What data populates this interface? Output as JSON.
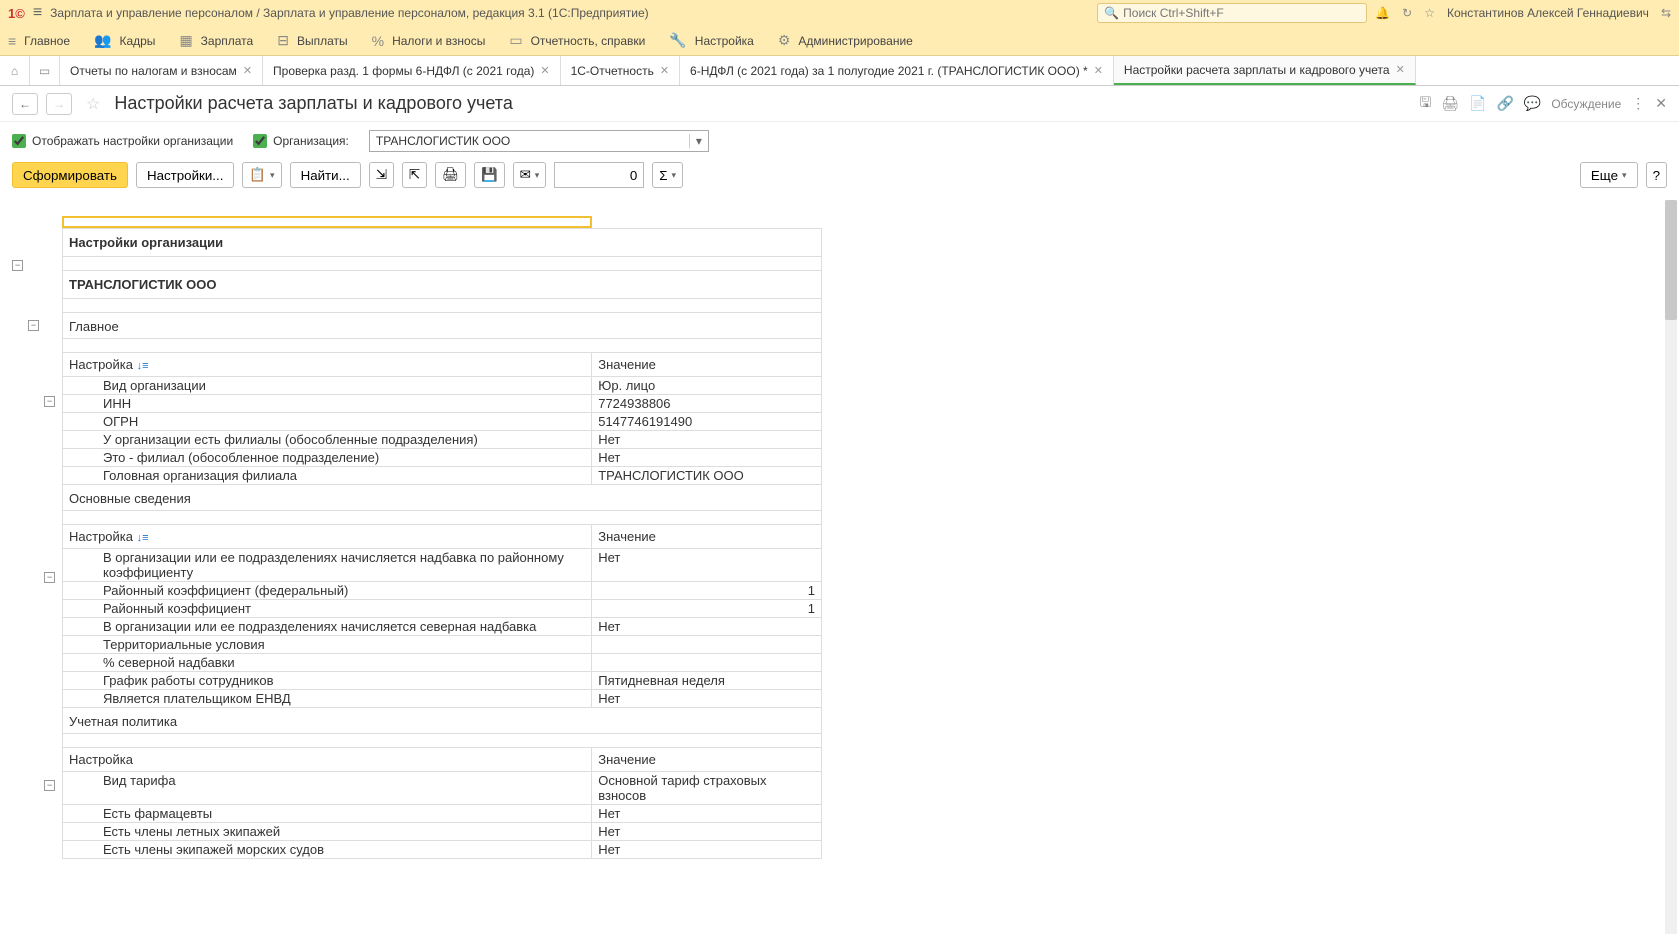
{
  "titlebar": {
    "app_title": "Зарплата и управление персоналом / Зарплата и управление персоналом, редакция 3.1  (1С:Предприятие)",
    "search_placeholder": "Поиск Ctrl+Shift+F",
    "user": "Константинов Алексей Геннадиевич"
  },
  "mainmenu": [
    {
      "icon": "≡",
      "label": "Главное"
    },
    {
      "icon": "👥",
      "label": "Кадры"
    },
    {
      "icon": "▦",
      "label": "Зарплата"
    },
    {
      "icon": "⊟",
      "label": "Выплаты"
    },
    {
      "icon": "%",
      "label": "Налоги и взносы"
    },
    {
      "icon": "▭",
      "label": "Отчетность, справки"
    },
    {
      "icon": "🔧",
      "label": "Настройка"
    },
    {
      "icon": "⚙",
      "label": "Администрирование"
    }
  ],
  "tabs": [
    {
      "label": "Отчеты по налогам и взносам",
      "close": true
    },
    {
      "label": "Проверка разд. 1 формы 6-НДФЛ (с 2021 года)",
      "close": true
    },
    {
      "label": "1С-Отчетность",
      "close": true
    },
    {
      "label": "6-НДФЛ (с 2021 года) за 1 полугодие 2021 г. (ТРАНСЛОГИСТИК ООО) *",
      "close": true
    },
    {
      "label": "Настройки расчета зарплаты и кадрового учета",
      "close": true,
      "active": true
    }
  ],
  "page": {
    "title": "Настройки расчета зарплаты и кадрового учета",
    "discuss": "Обсуждение"
  },
  "filters": {
    "show_org_settings": "Отображать настройки организации",
    "org_label": "Организация:",
    "org_value": "ТРАНСЛОГИСТИК ООО"
  },
  "toolbar": {
    "form": "Сформировать",
    "settings": "Настройки...",
    "find": "Найти...",
    "num_value": "0",
    "more": "Еще",
    "help": "?"
  },
  "report": {
    "h1": "Настройки организации",
    "org_name": "ТРАНСЛОГИСТИК ООО",
    "sections": [
      {
        "title": "Главное",
        "col1": "Настройка",
        "col2": "Значение",
        "sort": true,
        "rows": [
          {
            "k": "Вид организации",
            "v": "Юр. лицо"
          },
          {
            "k": "ИНН",
            "v": "7724938806"
          },
          {
            "k": "ОГРН",
            "v": "5147746191490"
          },
          {
            "k": "У организации есть филиалы (обособленные подразделения)",
            "v": "Нет"
          },
          {
            "k": "Это - филиал (обособленное подразделение)",
            "v": "Нет"
          },
          {
            "k": "Головная организация филиала",
            "v": "ТРАНСЛОГИСТИК ООО"
          }
        ]
      },
      {
        "title": "Основные сведения",
        "col1": "Настройка",
        "col2": "Значение",
        "sort": true,
        "rows": [
          {
            "k": "В организации или ее подразделениях начисляется надбавка по районному коэффициенту",
            "v": "Нет"
          },
          {
            "k": "Районный коэффициент (федеральный)",
            "v": "1",
            "r": true
          },
          {
            "k": "Районный коэффициент",
            "v": "1",
            "r": true
          },
          {
            "k": "В организации или ее подразделениях начисляется северная надбавка",
            "v": "Нет"
          },
          {
            "k": "Территориальные условия",
            "v": ""
          },
          {
            "k": "% северной надбавки",
            "v": ""
          },
          {
            "k": "График работы сотрудников",
            "v": "Пятидневная неделя"
          },
          {
            "k": "Является плательщиком ЕНВД",
            "v": "Нет"
          }
        ]
      },
      {
        "title": "Учетная политика",
        "col1": "Настройка",
        "col2": "Значение",
        "sort": false,
        "rows": [
          {
            "k": "Вид тарифа",
            "v": "Основной тариф страховых взносов"
          },
          {
            "k": "Есть фармацевты",
            "v": "Нет"
          },
          {
            "k": "Есть члены летных экипажей",
            "v": "Нет"
          },
          {
            "k": "Есть члены экипажей морских судов",
            "v": "Нет"
          }
        ]
      }
    ]
  }
}
